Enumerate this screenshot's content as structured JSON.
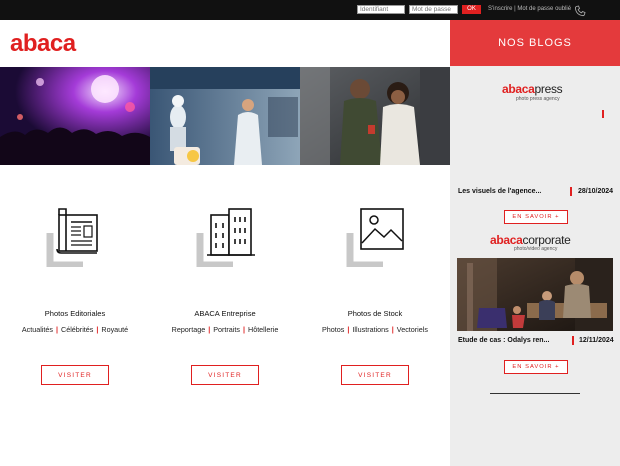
{
  "topbar": {
    "login_placeholder": "Identifiant",
    "password_placeholder": "Mot de passe",
    "ok_label": "OK",
    "links_text": "S'inscrire | Mot de passe oublié",
    "phone_icon": "phone-icon"
  },
  "header": {
    "logo": "abaca"
  },
  "categories": [
    {
      "title": "Photos Editoriales",
      "icon": "newspaper-icon",
      "links": [
        "Actualités",
        "Célébrités",
        "Royauté"
      ],
      "button": "VISITER"
    },
    {
      "title": "ABACA Entreprise",
      "icon": "building-icon",
      "links": [
        "Reportage",
        "Portraits",
        "Hôtellerie"
      ],
      "button": "VISITER"
    },
    {
      "title": "Photos de Stock",
      "icon": "landscape-image-icon",
      "links": [
        "Photos",
        "Illustrations",
        "Vectoriels"
      ],
      "button": "VISITER"
    }
  ],
  "blogs": {
    "heading": "NOS BLOGS",
    "press": {
      "brand_main": "abaca",
      "brand_suffix": "press",
      "tagline": "photo press agency",
      "post_title": "Les visuels de l'agence...",
      "post_date": "28/10/2024",
      "more_label": "EN SAVOIR +"
    },
    "corporate": {
      "brand_main": "abaca",
      "brand_suffix": "corporate",
      "tagline": "photo/video agency",
      "post_title": "Etude de cas : Odalys ren...",
      "post_date": "12/11/2024",
      "more_label": "EN SAVOIR +"
    }
  },
  "colors": {
    "brand_red": "#e02020",
    "blog_header_red": "#e43a3c",
    "panel_gray": "#ededed"
  }
}
